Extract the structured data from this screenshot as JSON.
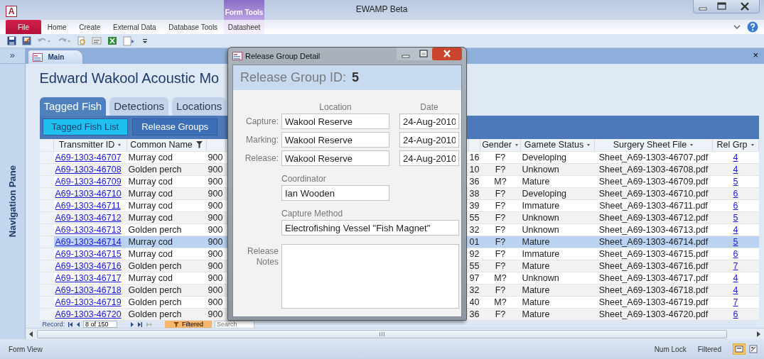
{
  "window": {
    "app_icon": "A",
    "context_group": "Form Tools",
    "title": "EWAMP Beta"
  },
  "ribbon": {
    "tabs": [
      {
        "label": "File",
        "kind": "file"
      },
      {
        "label": "Home",
        "kind": "standard"
      },
      {
        "label": "Create",
        "kind": "standard"
      },
      {
        "label": "External Data",
        "kind": "standard"
      },
      {
        "label": "Database Tools",
        "kind": "standard"
      },
      {
        "label": "Datasheet",
        "kind": "contextual"
      }
    ]
  },
  "navigation_pane": {
    "toggle": "»",
    "title": "Navigation Pane"
  },
  "document_tabs": [
    {
      "label": "Main",
      "selected": true,
      "close": "×"
    }
  ],
  "form": {
    "title": "Edward Wakool Acoustic Mo",
    "tabs": [
      {
        "label": "Tagged Fish",
        "selected": true
      },
      {
        "label": "Detections",
        "selected": false
      },
      {
        "label": "Locations",
        "selected": false
      }
    ],
    "subtabs": [
      {
        "label": "Tagged Fish List",
        "selected": true
      },
      {
        "label": "Release Groups",
        "selected": false
      }
    ],
    "table": {
      "columns": [
        {
          "label": "Transmitter ID",
          "kind": "link",
          "filtered": false
        },
        {
          "label": "Common Name",
          "kind": "text",
          "filtered": true
        },
        {
          "kind": "text"
        },
        {
          "kind": "text"
        },
        {
          "label": "Gender",
          "kind": "center",
          "filtered": false
        },
        {
          "label": "Gamete Status",
          "kind": "text",
          "filtered": false
        },
        {
          "label": "Surgery Sheet File",
          "kind": "text",
          "filtered": false
        },
        {
          "label": "Rel Grp",
          "kind": "link",
          "filtered": false
        }
      ],
      "rows": [
        {
          "cells": [
            "A69-1303-46707",
            "Murray cod",
            "900",
            "16",
            "F?",
            "Developing",
            "Sheet_A69-1303-46707.pdf",
            "4"
          ],
          "selected": false
        },
        {
          "cells": [
            "A69-1303-46708",
            "Golden perch",
            "900",
            "10",
            "F?",
            "Unknown",
            "Sheet_A69-1303-46708.pdf",
            "4"
          ],
          "selected": false
        },
        {
          "cells": [
            "A69-1303-46709",
            "Murray cod",
            "900",
            "36",
            "M?",
            "Mature",
            "Sheet_A69-1303-46709.pdf",
            "5"
          ],
          "selected": false
        },
        {
          "cells": [
            "A69-1303-46710",
            "Murray cod",
            "900",
            "38",
            "F?",
            "Developing",
            "Sheet_A69-1303-46710.pdf",
            "6"
          ],
          "selected": false
        },
        {
          "cells": [
            "A69-1303-46711",
            "Murray cod",
            "900",
            "39",
            "F?",
            "Immature",
            "Sheet_A69-1303-46711.pdf",
            "6"
          ],
          "selected": false
        },
        {
          "cells": [
            "A69-1303-46712",
            "Murray cod",
            "900",
            "55",
            "F?",
            "Unknown",
            "Sheet_A69-1303-46712.pdf",
            "5"
          ],
          "selected": false
        },
        {
          "cells": [
            "A69-1303-46713",
            "Golden perch",
            "900",
            "32",
            "F?",
            "Unknown",
            "Sheet_A69-1303-46713.pdf",
            "4"
          ],
          "selected": false
        },
        {
          "cells": [
            "A69-1303-46714",
            "Murray cod",
            "900",
            "01",
            "F?",
            "Mature",
            "Sheet_A69-1303-46714.pdf",
            "5"
          ],
          "selected": true
        },
        {
          "cells": [
            "A69-1303-46715",
            "Murray cod",
            "900",
            "92",
            "F?",
            "Immature",
            "Sheet_A69-1303-46715.pdf",
            "6"
          ],
          "selected": false
        },
        {
          "cells": [
            "A69-1303-46716",
            "Golden perch",
            "900",
            "55",
            "F?",
            "Mature",
            "Sheet_A69-1303-46716.pdf",
            "7"
          ],
          "selected": false
        },
        {
          "cells": [
            "A69-1303-46717",
            "Murray cod",
            "900",
            "97",
            "M?",
            "Unknown",
            "Sheet_A69-1303-46717.pdf",
            "4"
          ],
          "selected": false
        },
        {
          "cells": [
            "A69-1303-46718",
            "Golden perch",
            "900",
            "32",
            "F?",
            "Mature",
            "Sheet_A69-1303-46718.pdf",
            "4"
          ],
          "selected": false
        },
        {
          "cells": [
            "A69-1303-46719",
            "Golden perch",
            "900",
            "40",
            "M?",
            "Mature",
            "Sheet_A69-1303-46719.pdf",
            "7"
          ],
          "selected": false
        },
        {
          "cells": [
            "A69-1303-46720",
            "Golden perch",
            "900",
            "36",
            "F?",
            "Mature",
            "Sheet_A69-1303-46720.pdf",
            "6"
          ],
          "selected": false
        }
      ]
    },
    "record_nav": {
      "label": "Record:",
      "position": "8 of 150",
      "filter": "Filtered",
      "search_placeholder": "Search"
    }
  },
  "dialog": {
    "title": "Release Group Detail",
    "header_label": "Release Group ID:",
    "header_value": "5",
    "column_labels": [
      "Location",
      "Date"
    ],
    "events": [
      {
        "label": "Capture:",
        "location": "Wakool Reserve",
        "date": "24-Aug-2010"
      },
      {
        "label": "Marking:",
        "location": "Wakool Reserve",
        "date": "24-Aug-2010"
      },
      {
        "label": "Release:",
        "location": "Wakool Reserve",
        "date": "24-Aug-2010"
      }
    ],
    "coordinator": {
      "label": "Coordinator",
      "value": "Ian Wooden"
    },
    "capture_method": {
      "label": "Capture Method",
      "value": "Electrofishing Vessel \"Fish Magnet\""
    },
    "notes": {
      "label": "Release Notes"
    }
  },
  "status_bar": {
    "view": "Form View",
    "indicators": [
      "Num Lock",
      "Filtered"
    ]
  }
}
